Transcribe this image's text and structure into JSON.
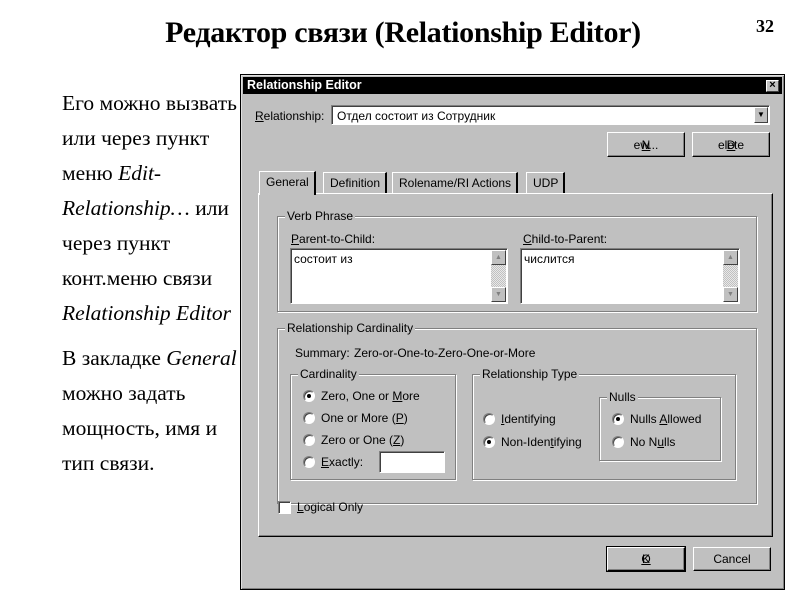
{
  "slide": {
    "title": "Редактор связи (Relationship Editor)",
    "page_number": "32",
    "paragraph1": {
      "part1": "Его можно вызвать или через пункт меню",
      "menu_item": "Edit-Relationship…",
      "part2": "или через пункт конт.меню связи",
      "context_item": "Relationship Editor"
    },
    "paragraph2": {
      "part1": "В закладке",
      "tab_name": "General",
      "part2": "можно задать мощность, имя и тип связи."
    }
  },
  "dialog": {
    "title": "Relationship Editor",
    "close_glyph": "×",
    "relationship_label_u": "R",
    "relationship_label_rest": "elationship:",
    "relationship_value": "Отдел состоит из Сотрудник",
    "dropdown_glyph": "▼",
    "new_button_u": "N",
    "new_button_rest": "ew...",
    "delete_button_u": "D",
    "delete_button_rest": "elete",
    "tabs": [
      {
        "label": "General",
        "active": true
      },
      {
        "label": "Definition",
        "active": false
      },
      {
        "label": "Rolename/RI Actions",
        "active": false
      },
      {
        "label": "UDP",
        "active": false
      }
    ],
    "verb_phrase": {
      "title": "Verb Phrase",
      "parent_label_u": "P",
      "parent_label_rest": "arent-to-Child:",
      "parent_value": "состоит из",
      "child_label_u": "C",
      "child_label_rest": "hild-to-Parent:",
      "child_value": "числится",
      "scroll_up": "▲",
      "scroll_down": "▼"
    },
    "cardinality_group": {
      "title": "Relationship Cardinality",
      "summary_label": "Summary:",
      "summary_value": "Zero-or-One-to-Zero-One-or-More",
      "cardinality": {
        "title": "Cardinality",
        "options": [
          {
            "pre": "Zero, One or ",
            "u": "M",
            "post": "ore",
            "checked": true
          },
          {
            "pre": "One or More (",
            "u": "P",
            "post": ")",
            "checked": false
          },
          {
            "pre": "Zero or One (",
            "u": "Z",
            "post": ")",
            "checked": false
          },
          {
            "pre": "",
            "u": "E",
            "post": "xactly:",
            "checked": false
          }
        ],
        "exactly_value": ""
      },
      "relationship_type": {
        "title": "Relationship Type",
        "options": [
          {
            "pre": "",
            "u": "I",
            "post": "dentifying",
            "checked": false
          },
          {
            "pre": "Non-Iden",
            "u": "t",
            "post": "ifying",
            "checked": true
          }
        ],
        "nulls": {
          "title": "Nulls",
          "options": [
            {
              "pre": "Nulls ",
              "u": "A",
              "post": "llowed",
              "checked": true
            },
            {
              "pre": "No N",
              "u": "u",
              "post": "lls",
              "checked": false
            }
          ]
        }
      }
    },
    "logical_only": {
      "u": "L",
      "rest": "ogical Only",
      "checked": false
    },
    "ok_button_u": "O",
    "ok_button_rest": "K",
    "cancel_button": "Cancel"
  }
}
